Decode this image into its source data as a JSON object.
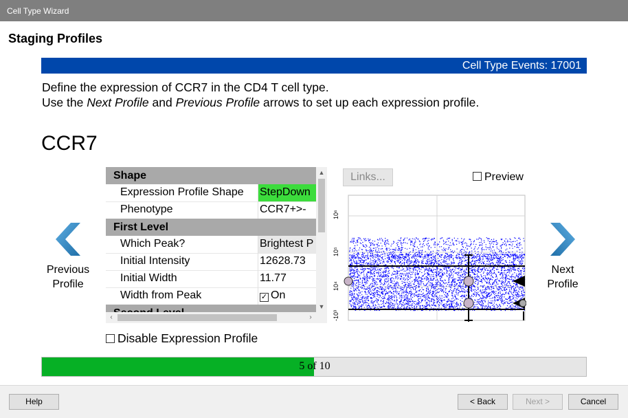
{
  "window": {
    "title": "Cell Type Wizard"
  },
  "header": {
    "title": "Staging Profiles"
  },
  "events_bar": {
    "text": "Cell Type Events: 17001",
    "color": "#0047ab"
  },
  "description": {
    "line1": "Define the expression of CCR7 in the CD4 T cell type.",
    "line2_a": "Use the ",
    "line2_b": "Next Profile",
    "line2_c": " and ",
    "line2_d": "Previous Profile",
    "line2_e": " arrows to set up each expression profile."
  },
  "marker": {
    "name": "CCR7"
  },
  "nav": {
    "previous": {
      "line1": "Previous",
      "line2": "Profile",
      "icon": "chevron-left-icon"
    },
    "next": {
      "line1": "Next",
      "line2": "Profile",
      "icon": "chevron-right-icon"
    },
    "arrow_color": "#2e86c1"
  },
  "property_grid": {
    "categories": {
      "shape": "Shape",
      "first_level": "First Level",
      "second_level": "Second Level"
    },
    "rows": [
      {
        "name": "Expression Profile Shape",
        "value": "StepDown"
      },
      {
        "name": "Phenotype",
        "value": "CCR7+>-"
      },
      {
        "name": "Which Peak?",
        "value": "Brightest P"
      },
      {
        "name": "Initial Intensity",
        "value": "12628.73"
      },
      {
        "name": "Initial Width",
        "value": "11.77"
      },
      {
        "name": "Width from Peak",
        "value": "On",
        "checked": true
      }
    ],
    "highlight_color": "#3cdc3c"
  },
  "links_button": {
    "label": "Links..."
  },
  "preview": {
    "label": "Preview",
    "checked": false
  },
  "plot": {
    "y_ticks": [
      "10⁶",
      "10⁵",
      "10⁴",
      "-10³"
    ],
    "dot_color": "#0000ff"
  },
  "disable_profile": {
    "label": "Disable Expression Profile",
    "checked": false
  },
  "progress": {
    "text": "5 of 10",
    "current": 5,
    "total": 10,
    "color": "#06b025"
  },
  "footer": {
    "help": "Help",
    "back": "< Back",
    "next": "Next >",
    "cancel": "Cancel"
  }
}
